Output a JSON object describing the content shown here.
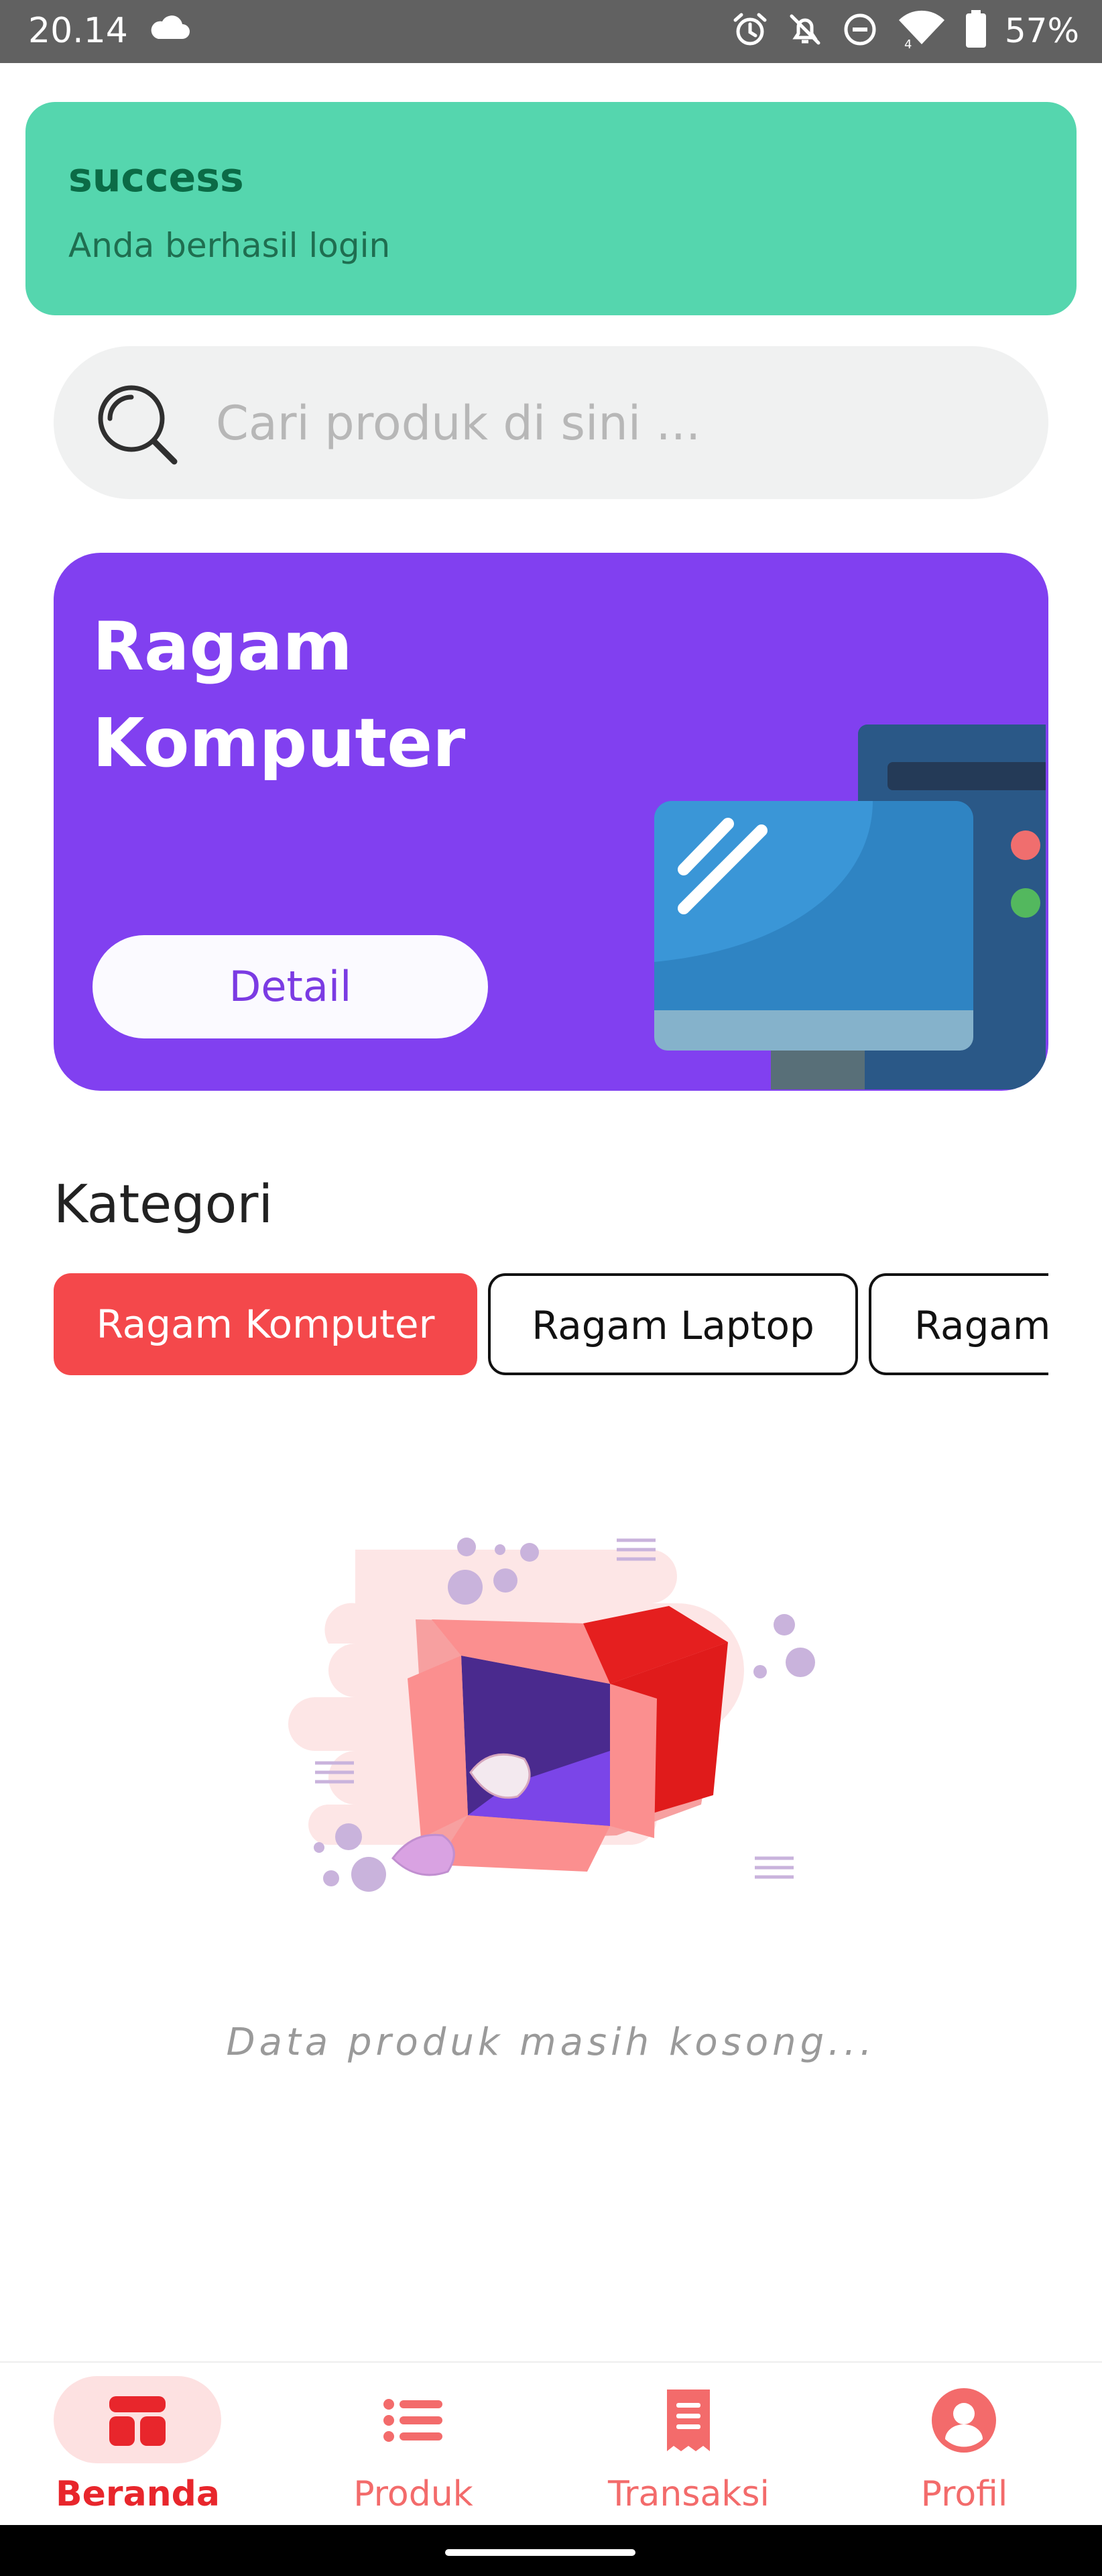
{
  "status_bar": {
    "time": "20.14",
    "battery": "57%",
    "icons": [
      "cloud-icon",
      "alarm-icon",
      "notifications-off-icon",
      "do-not-disturb-icon",
      "wifi-icon",
      "battery-icon"
    ]
  },
  "toast": {
    "title": "success",
    "message": "Anda berhasil login",
    "color": "#55d6ae"
  },
  "search": {
    "placeholder": "Cari produk di sini ..."
  },
  "banner": {
    "title": "Ragam Komputer",
    "button_label": "Detail",
    "color": "#8140f0"
  },
  "categories": {
    "heading": "Kategori",
    "items": [
      {
        "label": "Ragam Komputer",
        "active": true
      },
      {
        "label": "Ragam Laptop",
        "active": false
      },
      {
        "label": "Ragam",
        "active": false
      }
    ],
    "active_color": "#f4484b"
  },
  "empty_state": {
    "message": "Data produk masih kosong..."
  },
  "bottom_nav": {
    "items": [
      {
        "label": "Beranda",
        "icon": "home-icon",
        "active": true
      },
      {
        "label": "Produk",
        "icon": "list-icon",
        "active": false
      },
      {
        "label": "Transaksi",
        "icon": "receipt-icon",
        "active": false
      },
      {
        "label": "Profil",
        "icon": "profile-icon",
        "active": false
      }
    ],
    "accent_color": "#e8262c"
  }
}
